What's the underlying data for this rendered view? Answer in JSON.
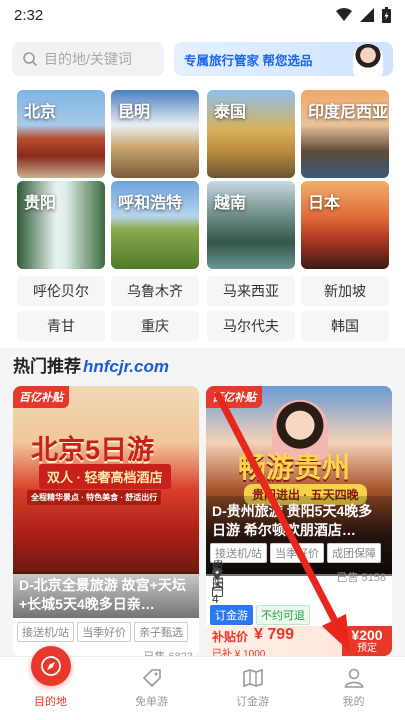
{
  "status": {
    "time": "2:32"
  },
  "search": {
    "placeholder": "目的地/关键词",
    "banner_text": "专属旅行管家 帮您选品"
  },
  "destinations": [
    {
      "label": "北京",
      "image": "forbidden-city"
    },
    {
      "label": "昆明",
      "image": "snow-mountain"
    },
    {
      "label": "泰国",
      "image": "temple"
    },
    {
      "label": "印度尼西亚",
      "image": "sea-temple"
    },
    {
      "label": "贵阳",
      "image": "waterfall"
    },
    {
      "label": "呼和浩特",
      "image": "grassland"
    },
    {
      "label": "越南",
      "image": "karst-bay"
    },
    {
      "label": "日本",
      "image": "pagoda-sunset"
    }
  ],
  "cities": [
    "呼伦贝尔",
    "乌鲁木齐",
    "马来西亚",
    "新加坡",
    "青甘",
    "重庆",
    "马尔代夫",
    "韩国"
  ],
  "section": {
    "title": "热门推荐",
    "watermark": "hnfcjr.com"
  },
  "cards": [
    {
      "badge": "百亿补贴",
      "poster_line1": "北京5日游",
      "poster_line2": "双人 · 轻奢高档酒店",
      "poster_line3": "全程精华景点 · 特色美食 · 舒适出行",
      "title": "D-北京全景旅游 故宫+天坛+长城5天4晚多日亲…",
      "tags": [
        "接送机/站",
        "当季好价",
        "亲子甄选"
      ],
      "sold": "已售 6823"
    },
    {
      "badge": "百亿补贴",
      "poster_line1": "畅游贵州",
      "poster_line2": "贵阳进出 · 五天四晚",
      "title": "D-贵州旅游 贵阳5天4晚多日游 希尔顿欢朋酒店…",
      "tags": [
        "接送机/站",
        "当季好价",
        "成团保障"
      ],
      "location": "贵阳",
      "sold": "已售 5158",
      "duration": "5天4晚",
      "extra_tags": [
        "订金游",
        "不约可退"
      ],
      "price_label": "补贴价",
      "price": "¥ 799",
      "subsidy": "已补 ¥ 1000",
      "coupon_amount": "¥200",
      "coupon_label": "预定"
    }
  ],
  "tabs": [
    {
      "label": "目的地",
      "active": true
    },
    {
      "label": "免单游",
      "active": false
    },
    {
      "label": "订金游",
      "active": false
    },
    {
      "label": "我的",
      "active": false
    }
  ],
  "colors": {
    "accent": "#e8382b",
    "blue": "#1b66e8"
  }
}
